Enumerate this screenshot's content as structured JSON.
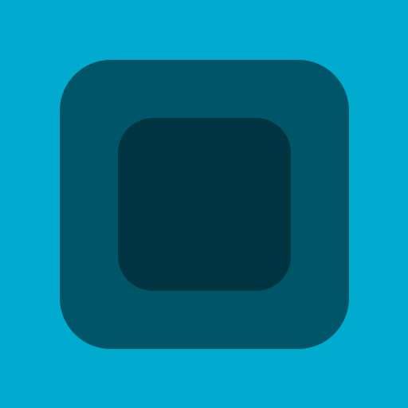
{
  "icon": {
    "name": "nested-rounded-square-icon",
    "colors": {
      "background": "#00abcf",
      "outer_square": "#005568",
      "inner_square": "#003441"
    }
  }
}
